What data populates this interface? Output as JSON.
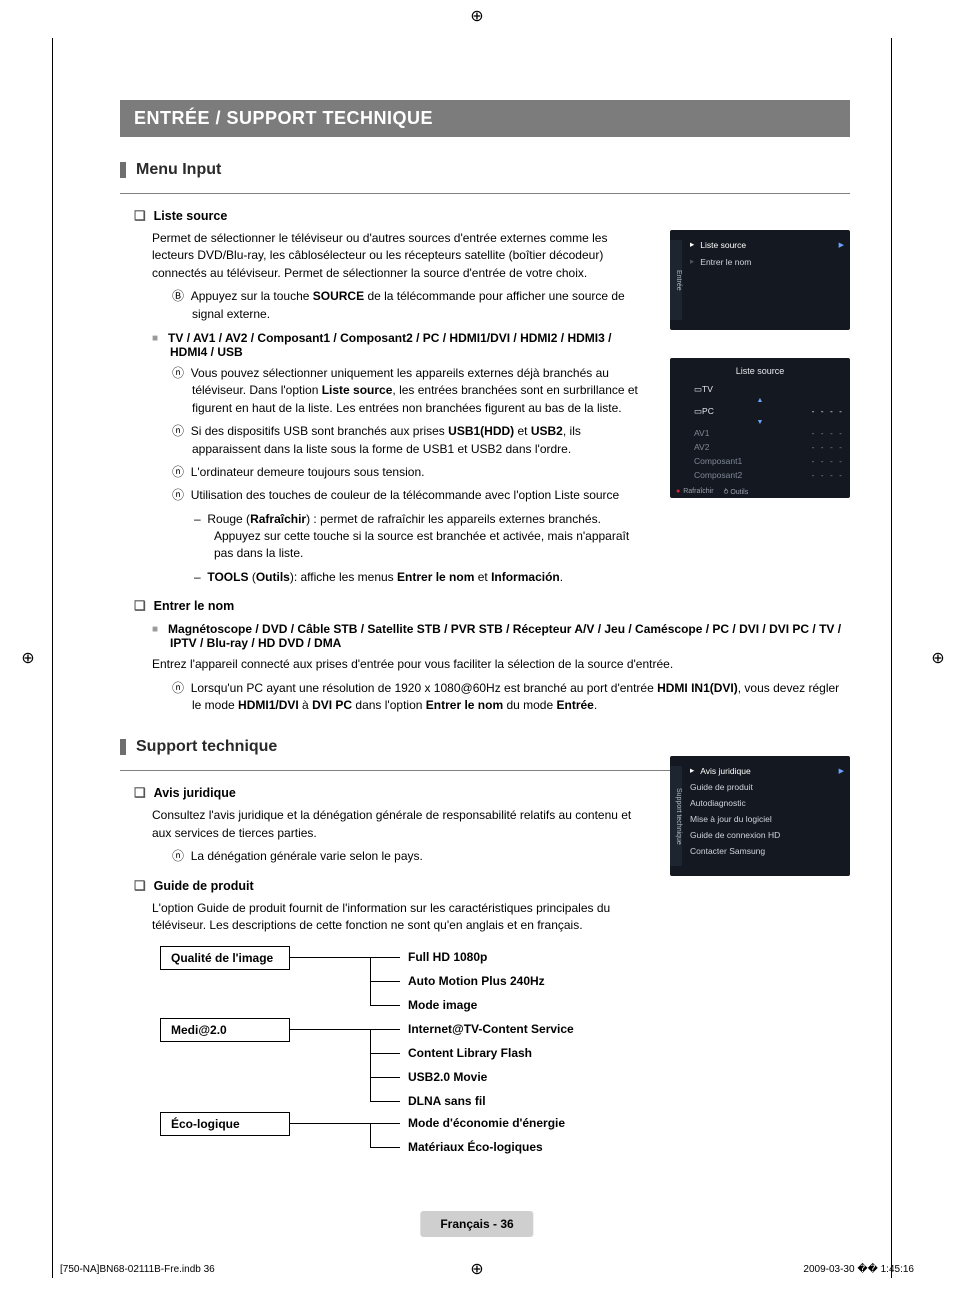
{
  "registration_icon": "⊕",
  "section_title": "ENTRÉE / SUPPORT TECHNIQUE",
  "menu_input": {
    "heading": "Menu Input",
    "source_list": {
      "title": "Liste source",
      "desc": "Permet de sélectionner le téléviseur ou d'autres sources d'entrée externes comme les lecteurs DVD/Blu-ray, les câblosélecteur ou les récepteurs satellite (boîtier décodeur) connectés au téléviseur. Permet de sélectionner la source d'entrée de votre choix.",
      "remote_note_pre": "Appuyez sur la touche ",
      "remote_note_bold": "SOURCE",
      "remote_note_post": " de la télécommande pour afficher une source de signal externe.",
      "source_options": "TV / AV1 / AV2 / Composant1 / Composant2 / PC / HDMI1/DVI / HDMI2 / HDMI3 / HDMI4 / USB",
      "n1_pre": "Vous pouvez sélectionner uniquement les appareils externes déjà branchés au téléviseur. Dans l'option ",
      "n1_b": "Liste source",
      "n1_post": ", les entrées branchées sont en surbrillance et figurent en haut de la liste. Les entrées non branchées figurent au bas de la liste.",
      "n2_pre": "Si des dispositifs USB sont branchés aux prises ",
      "n2_b1": "USB1(HDD)",
      "n2_mid": " et ",
      "n2_b2": "USB2",
      "n2_post": ", ils apparaissent dans la liste sous la forme de USB1 et USB2 dans l'ordre.",
      "n3": "L'ordinateur demeure toujours sous tension.",
      "n4": "Utilisation des touches de couleur de la télécommande avec l'option Liste source",
      "d1_pre": "Rouge (",
      "d1_b": "Rafraîchir",
      "d1_post": ") : permet de rafraîchir les appareils externes branchés. Appuyez sur cette touche si la source est branchée et activée, mais n'apparaît pas dans la liste.",
      "d2_b1": "TOOLS",
      "d2_mid1": " (",
      "d2_b2": "Outils",
      "d2_mid2": "): affiche les menus ",
      "d2_b3": "Entrer le nom",
      "d2_mid3": " et ",
      "d2_b4": "Información",
      "d2_post": "."
    },
    "edit_name": {
      "title": "Entrer le nom",
      "devices": "Magnétoscope / DVD / Câble STB / Satellite STB / PVR STB / Récepteur A/V / Jeu / Caméscope / PC / DVI / DVI PC / TV / IPTV / Blu-ray / HD DVD / DMA",
      "desc": "Entrez l'appareil connecté aux prises d'entrée pour vous faciliter la sélection de la source d'entrée.",
      "n_pre": "Lorsqu'un PC ayant une résolution de 1920 x 1080@60Hz est branché au port d'entrée ",
      "n_b1": "HDMI IN1(DVI)",
      "n_mid1": ", vous devez régler le mode ",
      "n_b2": "HDMI1/DVI",
      "n_mid2": " à ",
      "n_b3": "DVI PC",
      "n_mid3": " dans l'option ",
      "n_b4": "Entrer le nom",
      "n_mid4": " du mode ",
      "n_b5": "Entrée",
      "n_post": "."
    }
  },
  "support": {
    "heading": "Support technique",
    "legal": {
      "title": "Avis juridique",
      "desc": "Consultez l'avis juridique et la dénégation générale de responsabilité relatifs au contenu et aux services de tierces parties.",
      "note": "La dénégation générale varie selon le pays."
    },
    "guide": {
      "title": "Guide de produit",
      "desc": "L'option Guide de produit fournit de l'information sur les caractéristiques principales du téléviseur. Les descriptions de cette fonction ne sont qu'en anglais et en français."
    },
    "tree": {
      "box1": "Qualité de l'image",
      "box2": "Medi@2.0",
      "box3": "Éco-logique",
      "r1": "Full HD 1080p",
      "r2": "Auto Motion Plus 240Hz",
      "r3": "Mode image",
      "r4": "Internet@TV-Content Service",
      "r5": "Content Library Flash",
      "r6": "USB2.0 Movie",
      "r7": "DLNA sans fil",
      "r8": "Mode d'économie d'énergie",
      "r9": "Matériaux Éco-logiques"
    }
  },
  "screenshots": {
    "entree_tab": "Entrée",
    "s1_item1": "Liste source",
    "s1_item2": "Entrer le nom",
    "s2_title": "Liste source",
    "s2_tv": "TV",
    "s2_pc": "PC",
    "s2_av1": "AV1",
    "s2_av2": "AV2",
    "s2_c1": "Composant1",
    "s2_c2": "Composant2",
    "s2_dash": "- - - -",
    "s2_refresh": "Rafraîchir",
    "s2_tools": "Outils",
    "support_tab": "Support technique",
    "s3_i1": "Avis juridique",
    "s3_i2": "Guide de produit",
    "s3_i3": "Autodiagnostic",
    "s3_i4": "Mise à jour du logiciel",
    "s3_i5": "Guide de connexion HD",
    "s3_i6": "Contacter Samsung"
  },
  "footer": {
    "page": "Français - 36",
    "left": "[750-NA]BN68-02111B-Fre.indb   36",
    "right": "2009-03-30   �� 1:45:16"
  },
  "glyphs": {
    "remote": "Ⓑ",
    "note": "ⓝ",
    "dash": "–",
    "tools": "↙"
  }
}
